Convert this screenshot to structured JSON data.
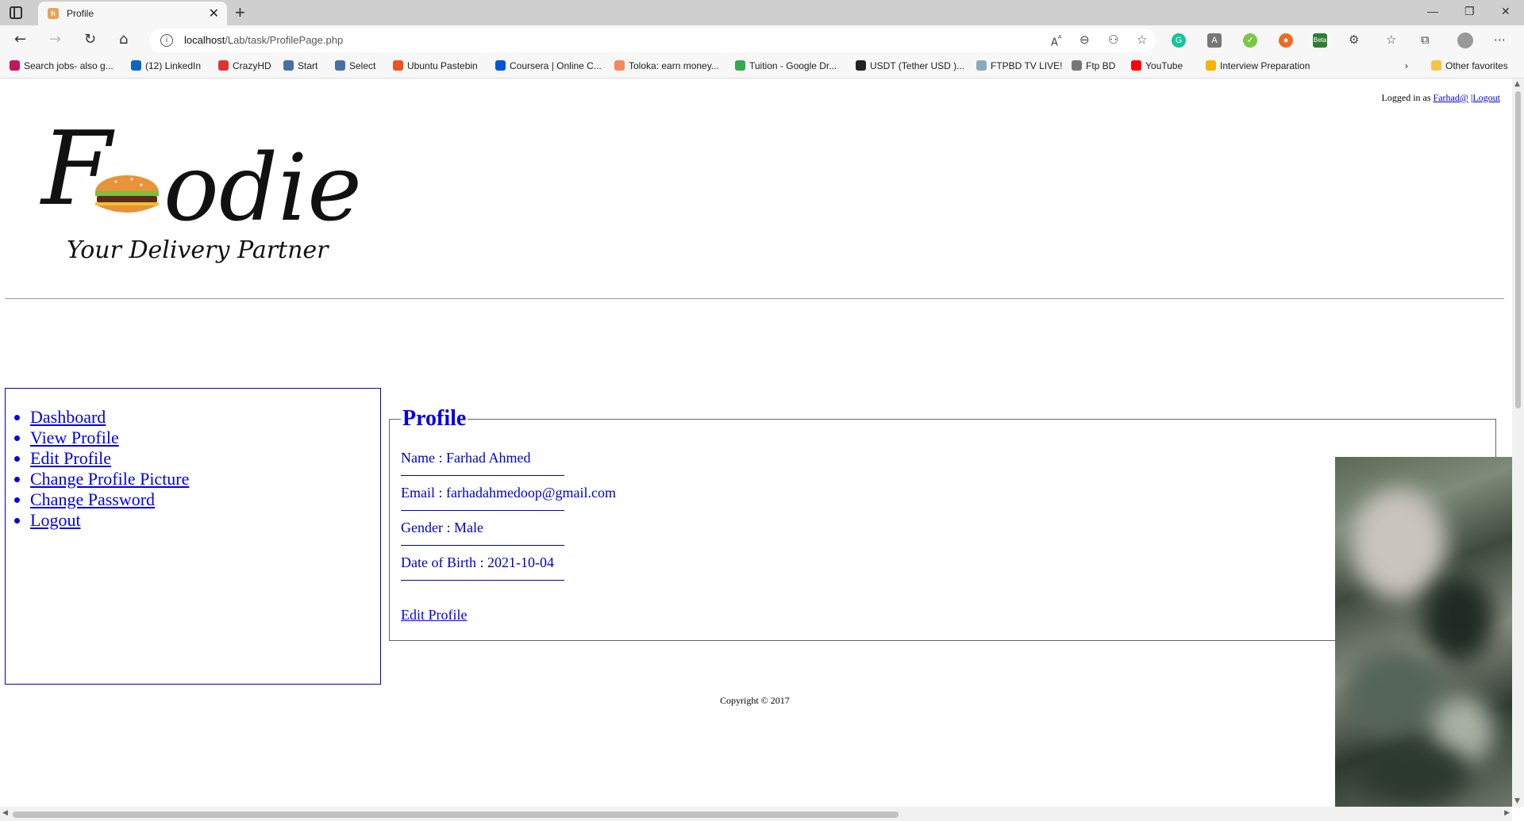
{
  "browser": {
    "tab_title": "Profile",
    "url_host": "localhost",
    "url_path": "/Lab/task/ProfilePage.php",
    "extension_beta_label": "Beta"
  },
  "bookmarks": [
    {
      "label": "Search jobs- also g...",
      "color": "#c2185b"
    },
    {
      "label": "(12) LinkedIn",
      "color": "#0a66c2"
    },
    {
      "label": "CrazyHD",
      "color": "#d33"
    },
    {
      "label": "Start",
      "color": "#4a6fa5"
    },
    {
      "label": "Select",
      "color": "#4a6fa5"
    },
    {
      "label": "Ubuntu Pastebin",
      "color": "#e95420"
    },
    {
      "label": "Coursera | Online C...",
      "color": "#0056d2"
    },
    {
      "label": "Toloka: earn money...",
      "color": "#f08a5d"
    },
    {
      "label": "Tuition - Google Dr...",
      "color": "#34a853"
    },
    {
      "label": "USDT (Tether USD )...",
      "color": "#222"
    },
    {
      "label": "FTPBD TV LIVE!",
      "color": "#8ab"
    },
    {
      "label": "Ftp BD",
      "color": "#777"
    },
    {
      "label": "YouTube",
      "color": "#f00"
    },
    {
      "label": "Interview Preparation",
      "color": "#f4b400"
    }
  ],
  "bookmarks_other": "Other favorites",
  "header": {
    "logo_text_left": "F",
    "logo_text_right": "odie",
    "logo_tagline": "Your Delivery Partner",
    "logged_in_prefix": "Logged in as",
    "username": "Farhad@",
    "separator": "|",
    "logout_link": "Logout"
  },
  "sidebar": {
    "items": [
      {
        "label": "Dashboard"
      },
      {
        "label": "View Profile"
      },
      {
        "label": "Edit Profile"
      },
      {
        "label": "Change Profile Picture"
      },
      {
        "label": "Change Password"
      },
      {
        "label": "Logout"
      }
    ]
  },
  "profile": {
    "legend": "Profile",
    "name": "Name : Farhad Ahmed",
    "email": "Email : farhadahmedoop@gmail.com",
    "gender": "Gender : Male",
    "dob": "Date of Birth : 2021-10-04",
    "edit_link": "Edit Profile"
  },
  "footer": {
    "copyright": "Copyright © 2017"
  }
}
